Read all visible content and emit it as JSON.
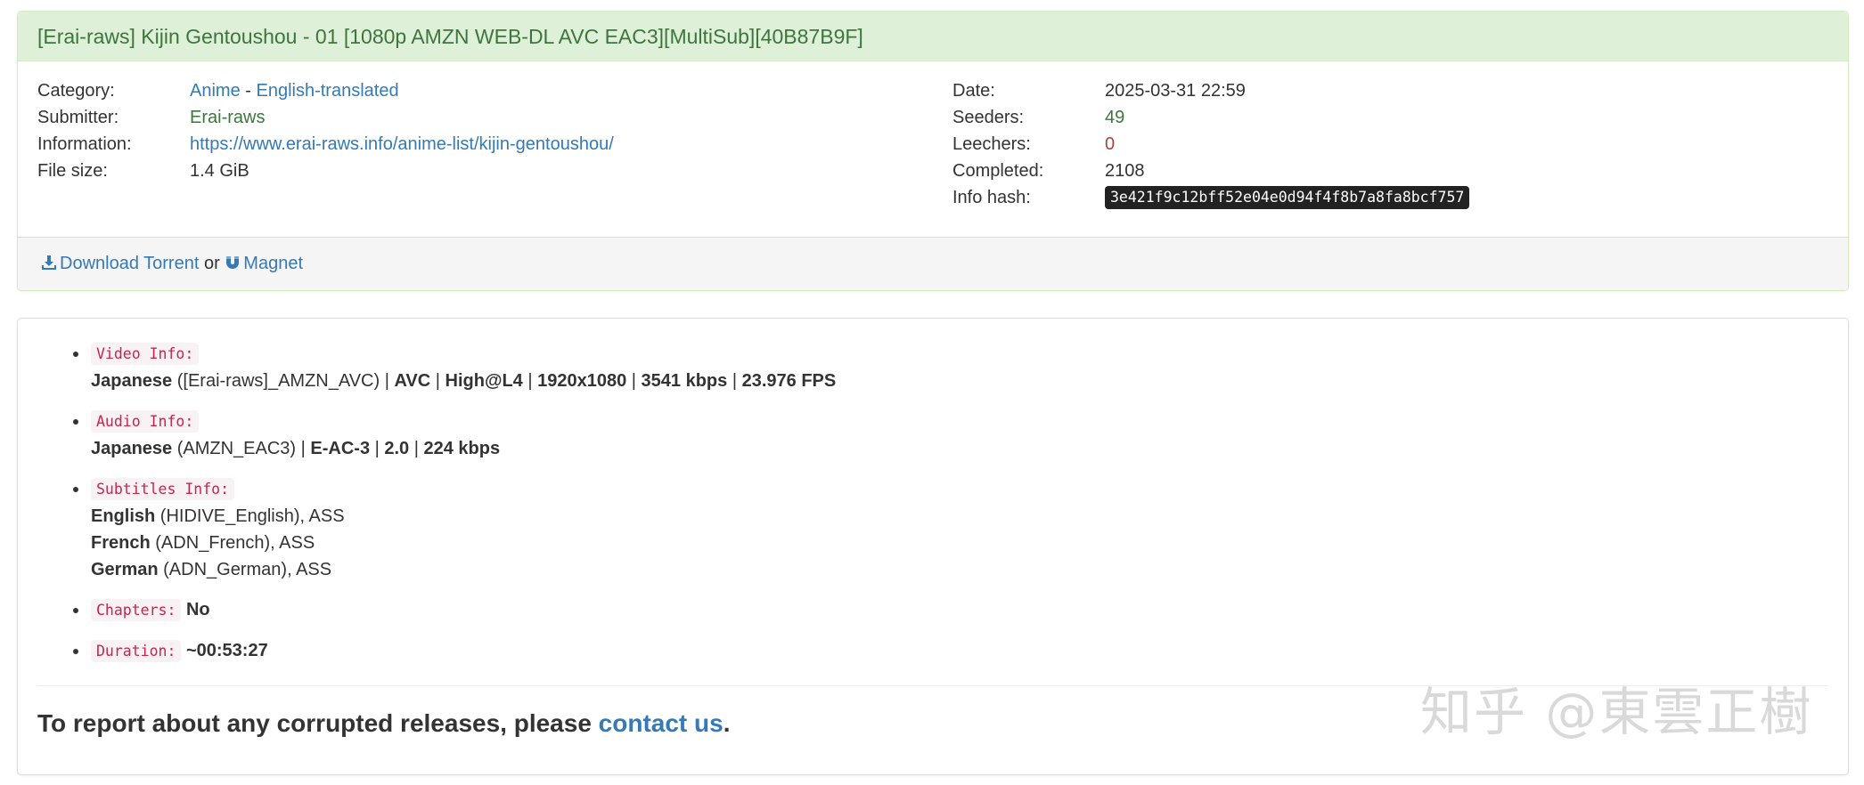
{
  "torrent": {
    "title": "[Erai-raws] Kijin Gentoushou - 01 [1080p AMZN WEB-DL AVC EAC3][MultiSub][40B87B9F]",
    "left": {
      "category_label": "Category:",
      "category_main": "Anime",
      "category_sep": " - ",
      "category_sub": "English-translated",
      "submitter_label": "Submitter:",
      "submitter": "Erai-raws",
      "information_label": "Information:",
      "information": "https://www.erai-raws.info/anime-list/kijin-gentoushou/",
      "filesize_label": "File size:",
      "filesize": "1.4 GiB"
    },
    "right": {
      "date_label": "Date:",
      "date": "2025-03-31 22:59",
      "seeders_label": "Seeders:",
      "seeders": "49",
      "leechers_label": "Leechers:",
      "leechers": "0",
      "completed_label": "Completed:",
      "completed": "2108",
      "infohash_label": "Info hash:",
      "infohash": "3e421f9c12bff52e04e0d94f4f8b7a8fa8bcf757"
    },
    "footer": {
      "download_label": "Download Torrent",
      "or": " or ",
      "magnet_label": "Magnet"
    },
    "colors": {
      "heading_bg": "#dff0d8",
      "heading_text": "#3c763d",
      "link": "#337ab7",
      "seeders": "#3c763d",
      "leechers": "#a94442"
    }
  },
  "description": {
    "video": {
      "tag": "Video Info:",
      "lang": "Japanese",
      "track": " ([Erai-raws]_AMZN_AVC) | ",
      "codec": "AVC",
      "s1": " | ",
      "profile": "High@L4",
      "s2": " | ",
      "resolution": "1920x1080",
      "s3": " | ",
      "bitrate": "3541 kbps",
      "s4": " | ",
      "fps": "23.976 FPS"
    },
    "audio": {
      "tag": "Audio Info:",
      "lang": "Japanese",
      "track": " (AMZN_EAC3) | ",
      "codec": "E-AC-3",
      "s1": " | ",
      "channels": "2.0",
      "s2": " | ",
      "bitrate": "224 kbps"
    },
    "subtitles": {
      "tag": "Subtitles Info:",
      "items": [
        {
          "lang": "English",
          "detail": " (HIDIVE_English), ASS"
        },
        {
          "lang": "French",
          "detail": " (ADN_French), ASS"
        },
        {
          "lang": "German",
          "detail": " (ADN_German), ASS"
        }
      ]
    },
    "chapters": {
      "tag": "Chapters:",
      "value": "No"
    },
    "duration": {
      "tag": "Duration:",
      "value": "~00:53:27"
    },
    "report": {
      "text": "To report about any corrupted releases, please ",
      "link": "contact us",
      "end": "."
    }
  },
  "watermark": "知乎 @東雲正樹"
}
